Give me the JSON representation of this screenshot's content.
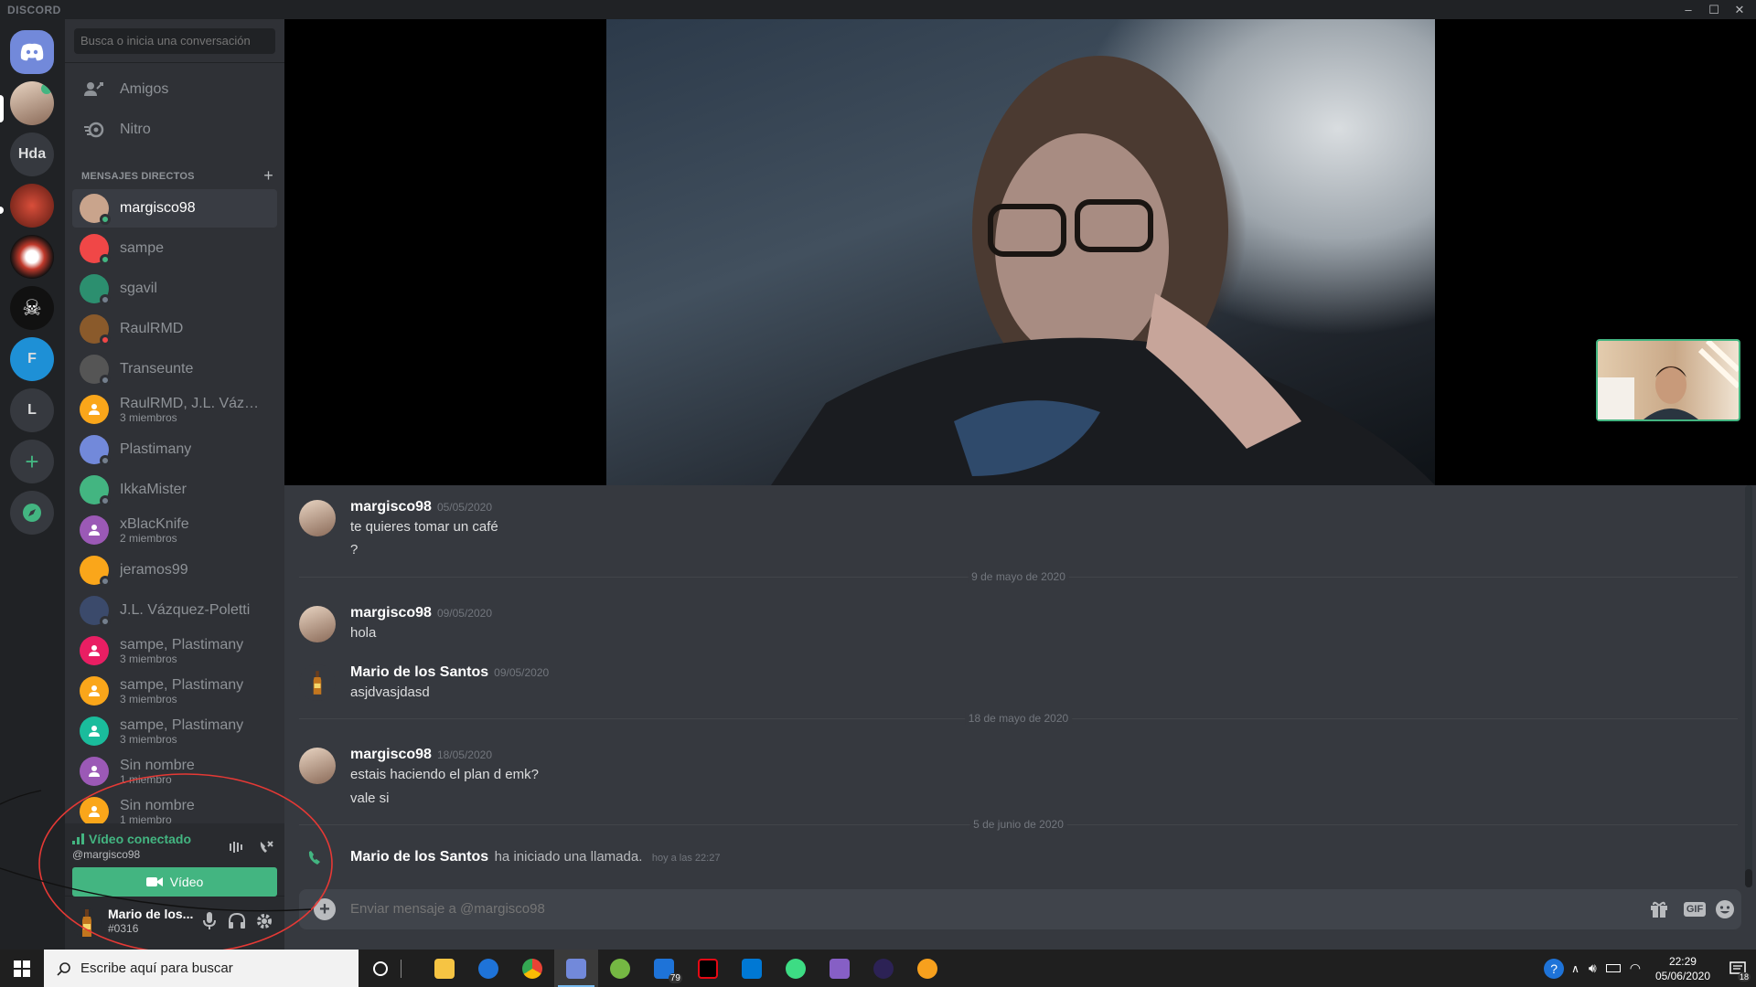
{
  "window": {
    "brand": "DISCORD",
    "controls": [
      "–",
      "☐",
      "✕"
    ]
  },
  "guilds": [
    {
      "type": "home",
      "label": ""
    },
    {
      "type": "dm-avatar",
      "label": ""
    },
    {
      "type": "text",
      "label": "Hda"
    },
    {
      "type": "image",
      "label": ""
    },
    {
      "type": "image",
      "label": ""
    },
    {
      "type": "image",
      "label": ""
    },
    {
      "type": "text",
      "label": "F"
    },
    {
      "type": "text",
      "label": "L"
    },
    {
      "type": "add",
      "label": "+"
    },
    {
      "type": "explore",
      "label": ""
    }
  ],
  "sidebar": {
    "search_placeholder": "Busca o inicia una conversación",
    "nav": [
      {
        "label": "Amigos",
        "icon": "friends-icon"
      },
      {
        "label": "Nitro",
        "icon": "nitro-icon"
      }
    ],
    "dm_header": "MENSAJES DIRECTOS",
    "dms": [
      {
        "name": "margisco98",
        "sub": "",
        "color": "#c9a48c",
        "status": "#43b581",
        "active": true
      },
      {
        "name": "sampe",
        "sub": "",
        "color": "#f04747",
        "status": "#43b581",
        "active": false
      },
      {
        "name": "sgavil",
        "sub": "",
        "color": "#2c8f6f",
        "status": "#747f8d",
        "active": false
      },
      {
        "name": "RaulRMD",
        "sub": "",
        "color": "#8a5a2b",
        "status": "#f04747",
        "active": false
      },
      {
        "name": "Transeunte",
        "sub": "",
        "color": "#555555",
        "status": "#747f8d",
        "active": false
      },
      {
        "name": "RaulRMD, J.L. Vázqu...",
        "sub": "3 miembros",
        "color": "#faa61a",
        "status": "",
        "active": false
      },
      {
        "name": "Plastimany",
        "sub": "",
        "color": "#7289da",
        "status": "#747f8d",
        "active": false
      },
      {
        "name": "IkkaMister",
        "sub": "",
        "color": "#43b581",
        "status": "#747f8d",
        "active": false
      },
      {
        "name": "xBlacKnife",
        "sub": "2 miembros",
        "color": "#9b59b6",
        "status": "",
        "active": false
      },
      {
        "name": "jeramos99",
        "sub": "",
        "color": "#faa61a",
        "status": "#747f8d",
        "active": false
      },
      {
        "name": "J.L. Vázquez-Poletti",
        "sub": "",
        "color": "#3b4a6b",
        "status": "#747f8d",
        "active": false
      },
      {
        "name": "sampe, Plastimany",
        "sub": "3 miembros",
        "color": "#e91e63",
        "status": "",
        "active": false
      },
      {
        "name": "sampe, Plastimany",
        "sub": "3 miembros",
        "color": "#faa61a",
        "status": "",
        "active": false
      },
      {
        "name": "sampe, Plastimany",
        "sub": "3 miembros",
        "color": "#1abc9c",
        "status": "",
        "active": false
      },
      {
        "name": "Sin nombre",
        "sub": "1 miembro",
        "color": "#9b59b6",
        "status": "",
        "active": false
      },
      {
        "name": "Sin nombre",
        "sub": "1 miembro",
        "color": "#faa61a",
        "status": "",
        "active": false
      }
    ]
  },
  "voice": {
    "status": "Vídeo conectado",
    "channel": "@margisco98",
    "video_button": "Vídeo"
  },
  "user": {
    "name": "Mario de los...",
    "tag": "#0316"
  },
  "messages": [
    {
      "author": "margisco98",
      "date": "05/05/2020",
      "lines": [
        "te quieres tomar un café",
        "?"
      ]
    },
    {
      "divider": "9 de mayo de 2020"
    },
    {
      "author": "margisco98",
      "date": "09/05/2020",
      "lines": [
        "hola"
      ]
    },
    {
      "author": "Mario de los Santos",
      "date": "09/05/2020",
      "lines": [
        "asjdvasjdasd"
      ]
    },
    {
      "divider": "18 de mayo de 2020"
    },
    {
      "author": "margisco98",
      "date": "18/05/2020",
      "lines": [
        "estais haciendo el plan d emk?",
        "vale si"
      ]
    },
    {
      "divider": "5 de junio de 2020"
    },
    {
      "system_author": "Mario de los Santos",
      "system_text": "ha iniciado una llamada.",
      "system_time": "hoy a las 22:27"
    }
  ],
  "composer": {
    "placeholder": "Enviar mensaje a @margisco98",
    "gif_label": "GIF"
  },
  "taskbar": {
    "search_placeholder": "Escribe aquí para buscar",
    "mail_badge": "79",
    "time": "22:29",
    "date": "05/06/2020",
    "notif_badge": "18"
  }
}
